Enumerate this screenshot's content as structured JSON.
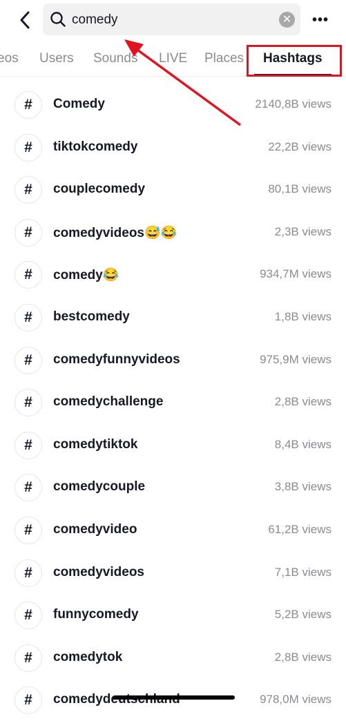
{
  "search": {
    "query": "comedy",
    "clear_icon": "x-circle-icon",
    "search_icon": "magnifier-icon"
  },
  "header": {
    "back_icon": "chevron-left-icon",
    "more_icon": "ellipsis-icon",
    "more_label": "•••"
  },
  "tabs": [
    {
      "label": "Videos",
      "visible_label": "eos"
    },
    {
      "label": "Users"
    },
    {
      "label": "Sounds"
    },
    {
      "label": "LIVE"
    },
    {
      "label": "Places"
    },
    {
      "label": "Hashtags",
      "active": true
    }
  ],
  "annotation": {
    "color": "#e0141e"
  },
  "hashtags": [
    {
      "name": "Comedy",
      "views": "2140,8B views"
    },
    {
      "name": "tiktokcomedy",
      "views": "22,2B views"
    },
    {
      "name": "couplecomedy",
      "views": "80,1B views"
    },
    {
      "name": "comedyvideos😅😂",
      "views": "2,3B views"
    },
    {
      "name": "comedy😂",
      "views": "934,7M views"
    },
    {
      "name": "bestcomedy",
      "views": "1,8B views"
    },
    {
      "name": "comedyfunnyvideos",
      "views": "975,9M views"
    },
    {
      "name": "comedychallenge",
      "views": "2,8B views"
    },
    {
      "name": "comedytiktok",
      "views": "8,4B views"
    },
    {
      "name": "comedycouple",
      "views": "3,8B views"
    },
    {
      "name": "comedyvideo",
      "views": "61,2B views"
    },
    {
      "name": "comedyvideos",
      "views": "7,1B views"
    },
    {
      "name": "funnycomedy",
      "views": "5,2B views"
    },
    {
      "name": "comedytok",
      "views": "2,8B views"
    },
    {
      "name": "comedydeutschland",
      "views": "978,0M views"
    }
  ],
  "hash_symbol": "#"
}
